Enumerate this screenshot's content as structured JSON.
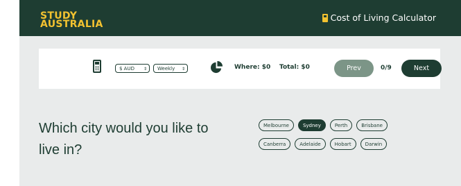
{
  "header": {
    "logo_line1": "STUDY",
    "logo_line2": "AUSTRALIA",
    "title": "Cost of Living Calculator",
    "title_icon": "calculator-icon"
  },
  "toolbar": {
    "currency": "$ AUD",
    "period": "Weekly",
    "where_text": "Where: $0",
    "total_text": "Total: $0",
    "prev_label": "Prev",
    "counter": "0/9",
    "next_label": "Next"
  },
  "question": "Which city would you like to live in?",
  "cities": {
    "row1": [
      "Melbourne",
      "Sydney",
      "Perth",
      "Brisbane"
    ],
    "row2": [
      "Canberra",
      "Adelaide",
      "Hobart",
      "Darwin"
    ],
    "selected": "Sydney"
  },
  "colors": {
    "brand_dark": "#1e3d32",
    "brand_yellow": "#f2c230",
    "background": "#e9ebeb"
  }
}
